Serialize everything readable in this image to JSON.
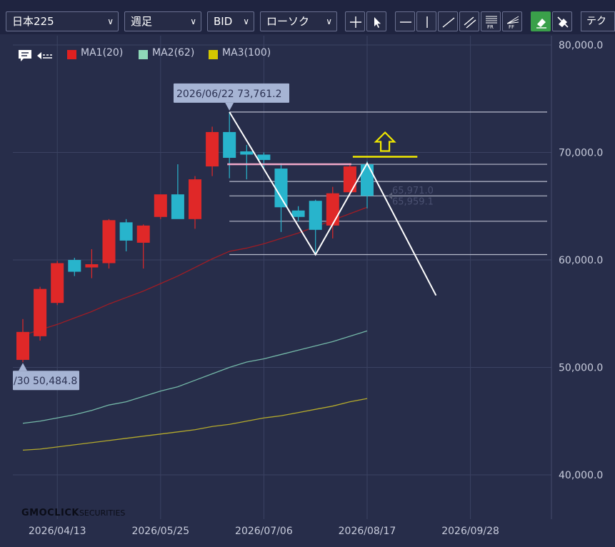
{
  "toolbar": {
    "symbol": "日本225",
    "period": "週足",
    "price_type": "BID",
    "chart_style": "ローソク",
    "technical_tab": "テクニ",
    "tools": [
      "crosshair-tool",
      "pointer-tool",
      "horizontal-line-tool",
      "vertical-line-tool",
      "trend-line-tool",
      "channel-tool",
      "fibonacci-retracement-tool",
      "fibonacci-fan-tool",
      "eraser-tool",
      "delete-all-tool"
    ]
  },
  "legend": {
    "items": [
      {
        "label": "MA1(20)",
        "color": "#e02020"
      },
      {
        "label": "MA2(62)",
        "color": "#8fd8b8"
      },
      {
        "label": "MA3(100)",
        "color": "#d4c800"
      }
    ]
  },
  "watermark": {
    "main": "GMOCLICK",
    "sub": "SECURITIES"
  },
  "colors": {
    "background": "#272d4a",
    "grid": "#3b4262",
    "up_candle": "#e02828",
    "down_candle": "#28b4cc",
    "axis_text": "#c8ccdc",
    "callout_bg": "#a6b4d4",
    "ma1": "#a01c24",
    "ma2": "#74b8a8",
    "ma3": "#b4aa2c",
    "drawing_white": "#ffffff",
    "drawing_pink": "#f0a8c8",
    "drawing_yellow": "#f0e800"
  },
  "chart_data": {
    "type": "candlestick",
    "x_ticks": [
      "2026/04/13",
      "2026/05/25",
      "2026/07/06",
      "2026/08/17",
      "2026/09/28"
    ],
    "y_ticks": [
      "40,000.0",
      "50,000.0",
      "60,000.0",
      "70,000.0",
      "80,000.0"
    ],
    "ylim": [
      36000,
      81000
    ],
    "grid": true,
    "candles": [
      {
        "date": "2026/03/30",
        "open": 50700,
        "high": 54500,
        "low": 50484.8,
        "close": 53300
      },
      {
        "date": "2026/04/06",
        "open": 52900,
        "high": 57500,
        "low": 52500,
        "close": 57300
      },
      {
        "date": "2026/04/13",
        "open": 56000,
        "high": 59900,
        "low": 55800,
        "close": 59700
      },
      {
        "date": "2026/04/20",
        "open": 60000,
        "high": 60200,
        "low": 58500,
        "close": 58900
      },
      {
        "date": "2026/04/27",
        "open": 59300,
        "high": 61000,
        "low": 58300,
        "close": 59600
      },
      {
        "date": "2026/05/04",
        "open": 59700,
        "high": 63800,
        "low": 59200,
        "close": 63700
      },
      {
        "date": "2026/05/11",
        "open": 63500,
        "high": 63800,
        "low": 60800,
        "close": 61800
      },
      {
        "date": "2026/05/18",
        "open": 61600,
        "high": 63300,
        "low": 59200,
        "close": 63200
      },
      {
        "date": "2026/05/25",
        "open": 64000,
        "high": 66000,
        "low": 63800,
        "close": 66100
      },
      {
        "date": "2026/06/01",
        "open": 66100,
        "high": 68900,
        "low": 64000,
        "close": 63800
      },
      {
        "date": "2026/06/08",
        "open": 63800,
        "high": 67800,
        "low": 62900,
        "close": 67500
      },
      {
        "date": "2026/06/15",
        "open": 68700,
        "high": 72400,
        "low": 67800,
        "close": 71900
      },
      {
        "date": "2026/06/22",
        "open": 71900,
        "high": 73761.2,
        "low": 67600,
        "close": 69500
      },
      {
        "date": "2026/06/29",
        "open": 70100,
        "high": 70700,
        "low": 67500,
        "close": 69800
      },
      {
        "date": "2026/07/06",
        "open": 69800,
        "high": 70000,
        "low": 68500,
        "close": 69300
      },
      {
        "date": "2026/07/13",
        "open": 68500,
        "high": 69000,
        "low": 62600,
        "close": 64900
      },
      {
        "date": "2026/07/20",
        "open": 64600,
        "high": 65000,
        "low": 63600,
        "close": 64000
      },
      {
        "date": "2026/07/27",
        "open": 65500,
        "high": 65600,
        "low": 60500,
        "close": 62800
      },
      {
        "date": "2026/08/03",
        "open": 63200,
        "high": 66800,
        "low": 62000,
        "close": 66200
      },
      {
        "date": "2026/08/10",
        "open": 66300,
        "high": 69000,
        "low": 66100,
        "close": 68700
      },
      {
        "date": "2026/08/17",
        "open": 68900,
        "high": 69200,
        "low": 64800,
        "close": 65959.1
      }
    ],
    "ma1": [
      53000,
      53500,
      54000,
      54600,
      55200,
      55900,
      56500,
      57100,
      57800,
      58500,
      59300,
      60100,
      60800,
      61100,
      61500,
      62000,
      62500,
      63100,
      63700,
      64300,
      64900
    ],
    "ma2": [
      44800,
      45000,
      45300,
      45600,
      46000,
      46500,
      46800,
      47300,
      47800,
      48200,
      48800,
      49400,
      50000,
      50500,
      50800,
      51200,
      51600,
      52000,
      52400,
      52900,
      53400
    ],
    "ma3": [
      42300,
      42400,
      42600,
      42800,
      43000,
      43200,
      43400,
      43600,
      43800,
      44000,
      44200,
      44500,
      44700,
      45000,
      45300,
      45500,
      45800,
      46100,
      46400,
      46800,
      47100
    ],
    "callouts": [
      {
        "text": "2026/06/22 73,761.2",
        "date": "2026/06/22",
        "value": 73761.2,
        "pointer": "down"
      },
      {
        "text": "/30 50,484.8",
        "date": "2026/03/30",
        "value": 50484.8,
        "pointer": "up"
      }
    ],
    "price_labels": [
      "65,971.0",
      "65,959.1"
    ],
    "fibonacci_levels": [
      73761.2,
      68900,
      67300,
      65959.1,
      63600,
      60500
    ],
    "annotations": {
      "pink_resistance": 68900,
      "yellow_resistance": 69600,
      "arrow": "up",
      "double_top_pattern": true
    }
  }
}
